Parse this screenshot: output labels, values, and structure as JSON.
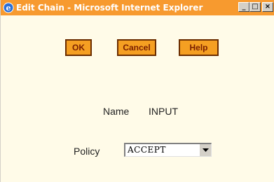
{
  "window": {
    "title": "Edit Chain - Microsoft Internet Explorer",
    "controls": {
      "minimize": "_",
      "maximize": "□",
      "close": "×"
    }
  },
  "toolbar": {
    "ok_label": "OK",
    "cancel_label": "Cancel",
    "help_label": "Help"
  },
  "form": {
    "name_label": "Name",
    "name_value": "INPUT",
    "policy_label": "Policy",
    "policy_value": "ACCEPT"
  },
  "icons": {
    "app": "ie-icon",
    "dropdown": "chevron-down-icon"
  },
  "colors": {
    "titlebar": "#f79a2f",
    "background": "#fffbe8",
    "button_fill": "#f59f22",
    "button_border": "#6a2c00",
    "button_text": "#7a1f00"
  }
}
